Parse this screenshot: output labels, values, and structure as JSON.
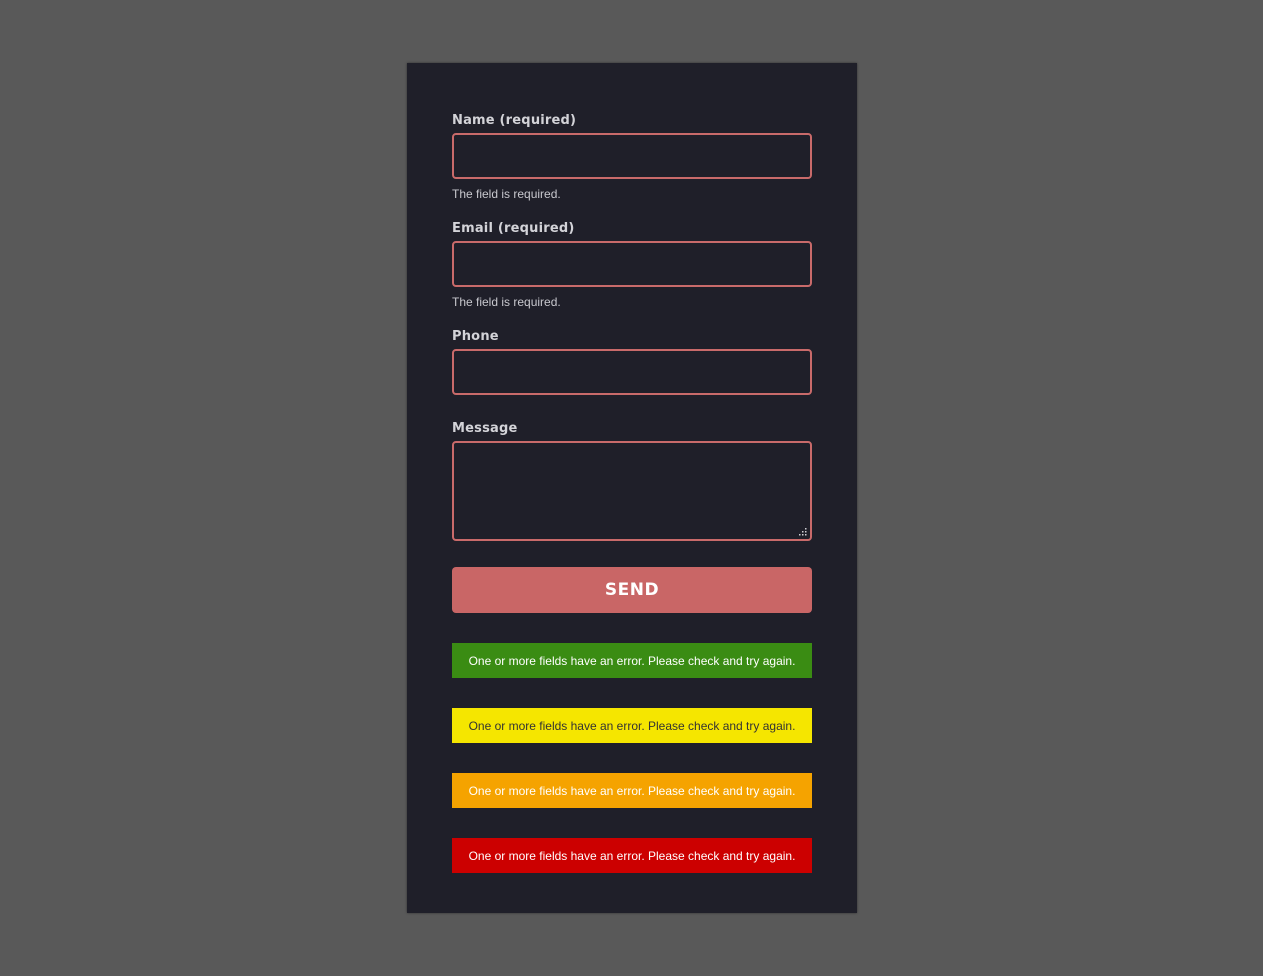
{
  "form": {
    "fields": {
      "name": {
        "label": "Name (required)",
        "value": "",
        "error": "The field is required."
      },
      "email": {
        "label": "Email (required)",
        "value": "",
        "error": "The field is required."
      },
      "phone": {
        "label": "Phone",
        "value": ""
      },
      "message": {
        "label": "Message",
        "value": ""
      }
    },
    "send_label": "SEND"
  },
  "alerts": [
    {
      "type": "success",
      "text": "One or more fields have an error. Please check and try again.",
      "bg": "#3a8c13",
      "fg": "#ffffff"
    },
    {
      "type": "warning",
      "text": "One or more fields have an error. Please check and try again.",
      "bg": "#f5e600",
      "fg": "#333333"
    },
    {
      "type": "caution",
      "text": "One or more fields have an error. Please check and try again.",
      "bg": "#f5a300",
      "fg": "#ffffff"
    },
    {
      "type": "error",
      "text": "One or more fields have an error. Please check and try again.",
      "bg": "#cc0000",
      "fg": "#ffffff"
    }
  ],
  "colors": {
    "page_bg": "#595959",
    "card_bg": "#1f1f29",
    "accent": "#c96666",
    "field_border": "#c96a6a"
  }
}
